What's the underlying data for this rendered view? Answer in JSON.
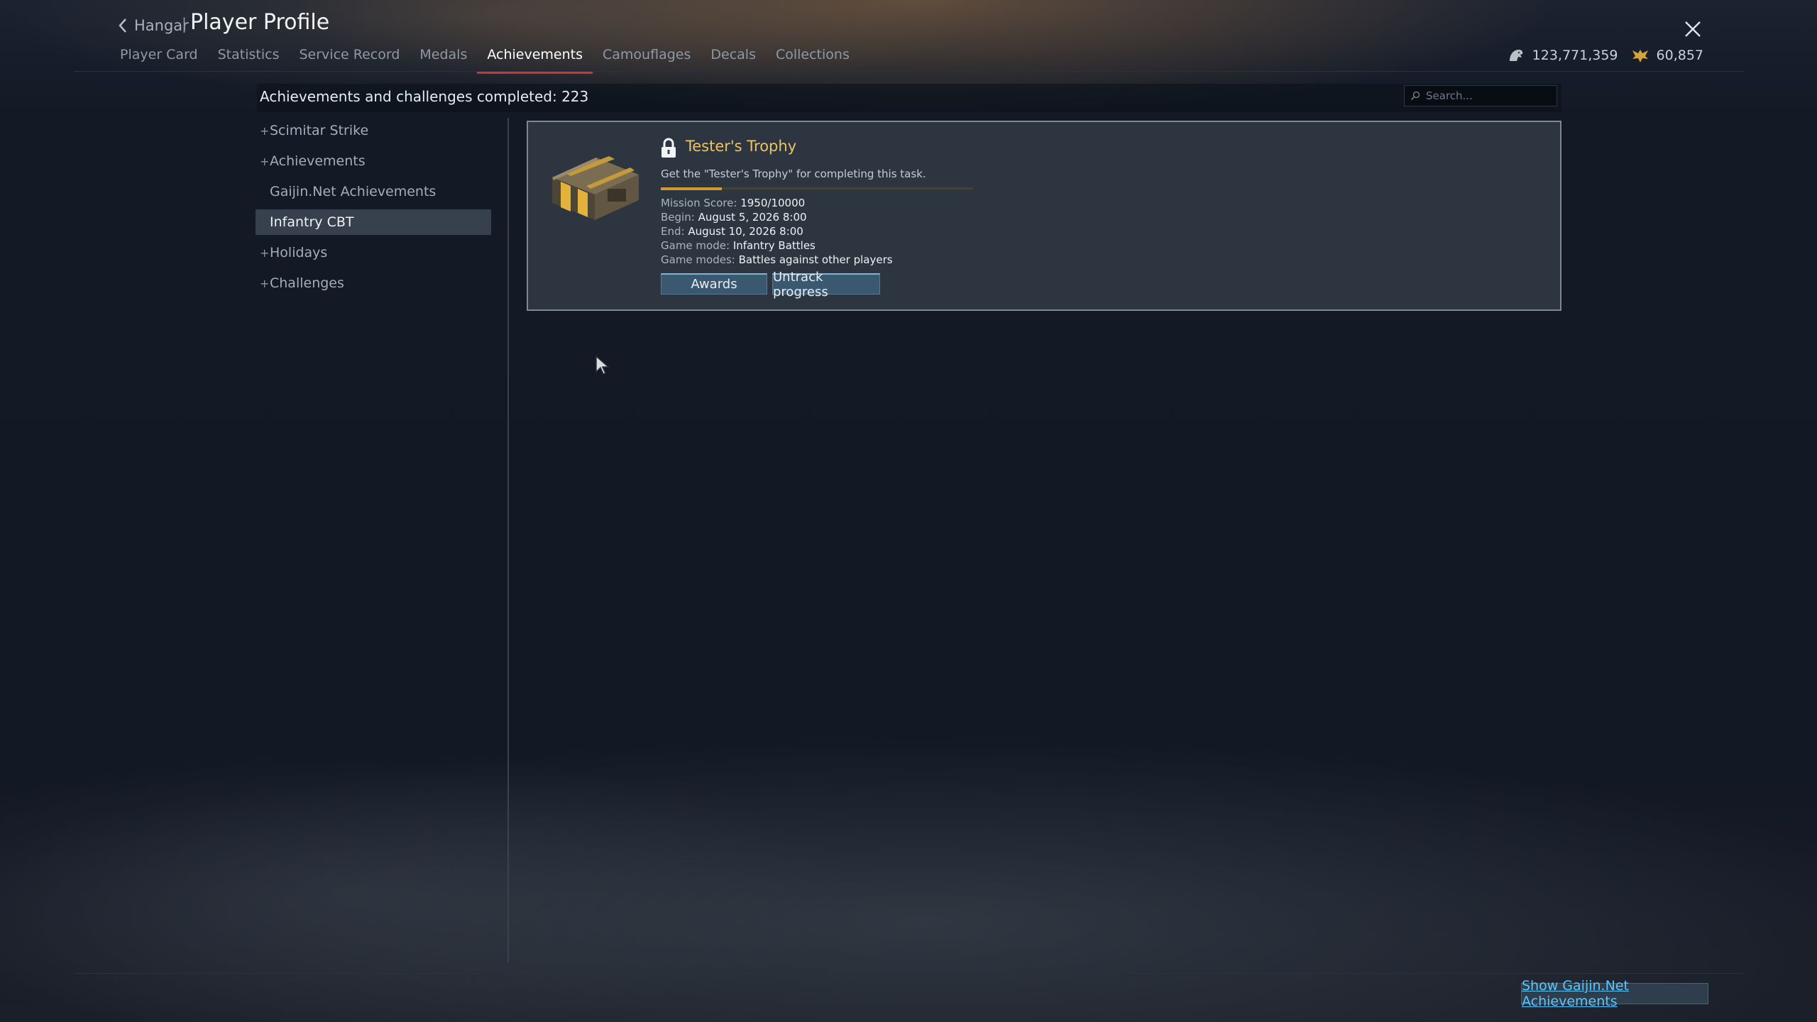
{
  "header": {
    "back_label": "Hangar",
    "separator": "|",
    "title": "Player Profile"
  },
  "tabs": [
    {
      "label": "Player Card"
    },
    {
      "label": "Statistics"
    },
    {
      "label": "Service Record"
    },
    {
      "label": "Medals"
    },
    {
      "label": "Achievements",
      "active": true
    },
    {
      "label": "Camouflages"
    },
    {
      "label": "Decals"
    },
    {
      "label": "Collections"
    }
  ],
  "currency": {
    "silver_lions": "123,771,359",
    "golden_eagles": "60,857"
  },
  "summary": {
    "text": "Achievements and challenges completed: 223",
    "search_placeholder": "Search..."
  },
  "sidebar": {
    "items": [
      {
        "label": "Scimitar Strike",
        "expandable": true
      },
      {
        "label": "Achievements",
        "expandable": true
      },
      {
        "label": "Gaijin.Net Achievements",
        "expandable": false
      },
      {
        "label": "Infantry CBT",
        "expandable": false,
        "selected": true
      },
      {
        "label": "Holidays",
        "expandable": true
      },
      {
        "label": "Challenges",
        "expandable": true
      }
    ],
    "plus_glyph": "+"
  },
  "card": {
    "title": "Tester's Trophy",
    "description": "Get the \"Tester's Trophy\" for completing this task.",
    "progress": {
      "current": 1950,
      "total": 10000
    },
    "lines": [
      {
        "label": "Mission Score:",
        "value": "1950/10000"
      },
      {
        "label": "Begin:",
        "value": "August 5, 2026 8:00"
      },
      {
        "label": "End:",
        "value": "August 10, 2026 8:00"
      },
      {
        "label": "Game mode:",
        "value": "Infantry Battles"
      },
      {
        "label": "Game modes:",
        "value": "Battles against other players"
      }
    ],
    "awards_label": "Awards",
    "untrack_label": "Untrack progress"
  },
  "footer": {
    "gaijin_button": "Show Gaijin.Net Achievements"
  },
  "colors": {
    "accent_red": "#c33838",
    "title_gold": "#e9c36a",
    "progress_fill": "#d19a2e",
    "link_blue": "#59c7ff"
  },
  "icons": {
    "back": "chevron-left-icon",
    "close": "close-icon",
    "silver": "silver-lions-icon",
    "gold": "golden-eagles-icon",
    "search": "search-icon",
    "lock": "lock-icon",
    "reward": "trophy-chest-icon"
  }
}
